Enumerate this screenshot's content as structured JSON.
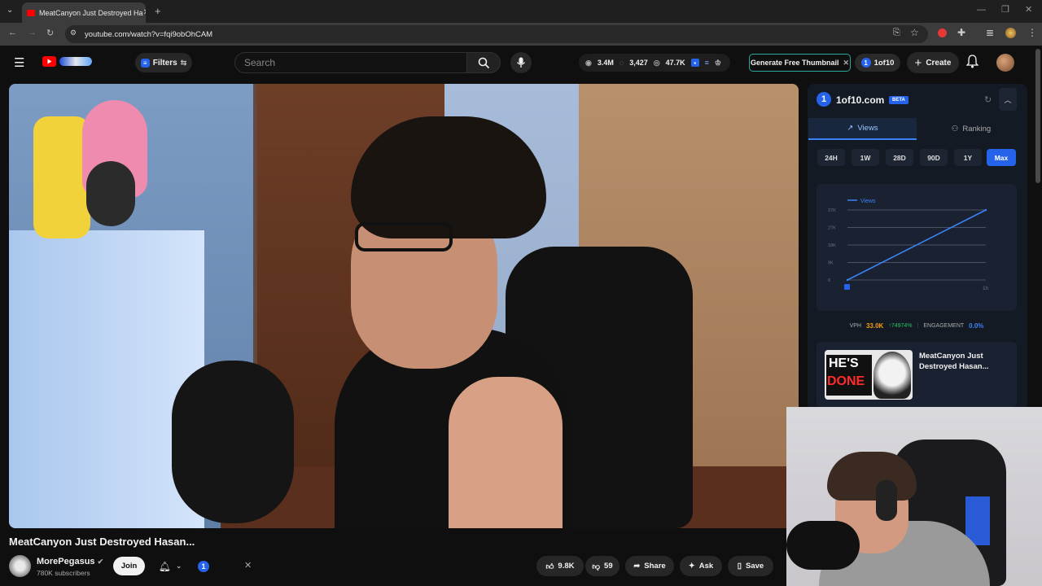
{
  "browser": {
    "tab_title": "MeatCanyon Just Destroyed Ha",
    "url": "youtube.com/watch?v=fqi9obOhCAM"
  },
  "header": {
    "filters_label": "Filters",
    "search_placeholder": "Search",
    "stats": {
      "views": "3.4M",
      "comments": "3,427",
      "live": "47.7K"
    },
    "generate_thumbnail_label": "Generate Free Thumbnail",
    "oneof10_label": "1of10",
    "create_label": "Create"
  },
  "panel": {
    "title": "1of10.com",
    "badge": "BETA",
    "tabs": [
      {
        "label": "Views"
      },
      {
        "label": "Ranking"
      }
    ],
    "ranges": [
      "24H",
      "1W",
      "28D",
      "90D",
      "1Y",
      "Max"
    ],
    "active_range": "Max",
    "metrics": {
      "vph_label": "VPH",
      "vph_value": "33.0K",
      "vph_change": "↑74974%",
      "engagement_label": "ENGAGEMENT",
      "engagement_value": "0.0%"
    },
    "card_title": "MeatCanyon Just Destroyed Hasan...",
    "thumb_text": [
      "HE'S",
      "DONE"
    ]
  },
  "chart_data": {
    "type": "line",
    "legend": [
      "Views"
    ],
    "yticks": [
      "0",
      "9K",
      "18K",
      "27K",
      "37K"
    ],
    "xticks": [
      "",
      "1h"
    ],
    "series": [
      {
        "name": "Views",
        "x": [
          0,
          1
        ],
        "y": [
          0,
          37000
        ]
      }
    ],
    "ylim": [
      0,
      37000
    ],
    "grid": true,
    "legend_position": "top-left"
  },
  "video": {
    "title": "MeatCanyon Just Destroyed Hasan...",
    "channel": "MorePegasus",
    "subscribers": "780K subscribers",
    "join_label": "Join",
    "likes": "9.8K",
    "dislikes": "59",
    "share_label": "Share",
    "ask_label": "Ask",
    "save_label": "Save"
  },
  "colors": {
    "accent": "#2563eb",
    "youtube_red": "#ff0000",
    "teal": "#2aa89c"
  }
}
